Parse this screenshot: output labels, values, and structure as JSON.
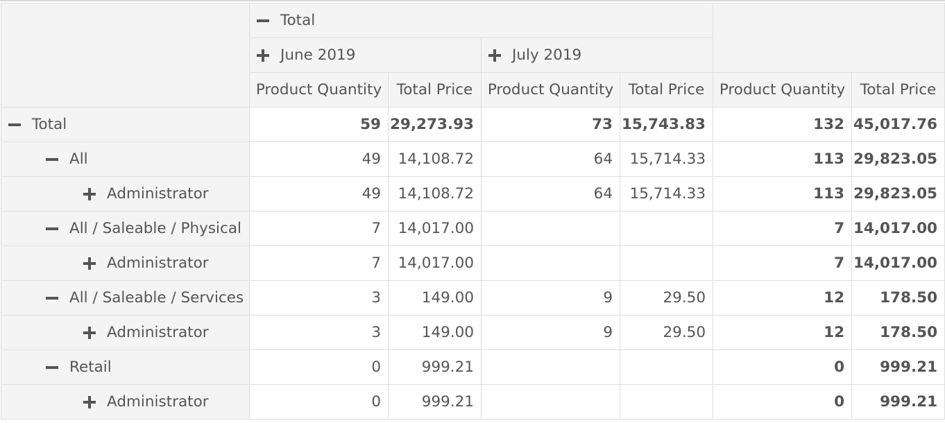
{
  "column_headers": {
    "total_label": "Total",
    "groups": [
      {
        "label": "June 2019",
        "expand_icon": "plus-icon"
      },
      {
        "label": "July 2019",
        "expand_icon": "plus-icon"
      }
    ],
    "measures": [
      "Product Quantity",
      "Total Price",
      "Product Quantity",
      "Total Price",
      "Product Quantity",
      "Total Price"
    ]
  },
  "rows": [
    {
      "label": "Total",
      "level": 0,
      "icon": "minus-icon",
      "values": [
        "59",
        "29,273.93",
        "73",
        "15,743.83",
        "132",
        "45,017.76"
      ]
    },
    {
      "label": "All",
      "level": 1,
      "icon": "minus-icon",
      "values": [
        "49",
        "14,108.72",
        "64",
        "15,714.33",
        "113",
        "29,823.05"
      ]
    },
    {
      "label": "Administrator",
      "level": 2,
      "icon": "plus-icon",
      "values": [
        "49",
        "14,108.72",
        "64",
        "15,714.33",
        "113",
        "29,823.05"
      ]
    },
    {
      "label": "All / Saleable / Physical",
      "level": 1,
      "icon": "minus-icon",
      "values": [
        "7",
        "14,017.00",
        "",
        "",
        "7",
        "14,017.00"
      ]
    },
    {
      "label": "Administrator",
      "level": 2,
      "icon": "plus-icon",
      "values": [
        "7",
        "14,017.00",
        "",
        "",
        "7",
        "14,017.00"
      ]
    },
    {
      "label": "All / Saleable / Services",
      "level": 1,
      "icon": "minus-icon",
      "values": [
        "3",
        "149.00",
        "9",
        "29.50",
        "12",
        "178.50"
      ]
    },
    {
      "label": "Administrator",
      "level": 2,
      "icon": "plus-icon",
      "values": [
        "3",
        "149.00",
        "9",
        "29.50",
        "12",
        "178.50"
      ]
    },
    {
      "label": "Retail",
      "level": 1,
      "icon": "minus-icon",
      "values": [
        "0",
        "999.21",
        "",
        "",
        "0",
        "999.21"
      ]
    },
    {
      "label": "Administrator",
      "level": 2,
      "icon": "plus-icon",
      "values": [
        "0",
        "999.21",
        "",
        "",
        "0",
        "999.21"
      ]
    }
  ]
}
